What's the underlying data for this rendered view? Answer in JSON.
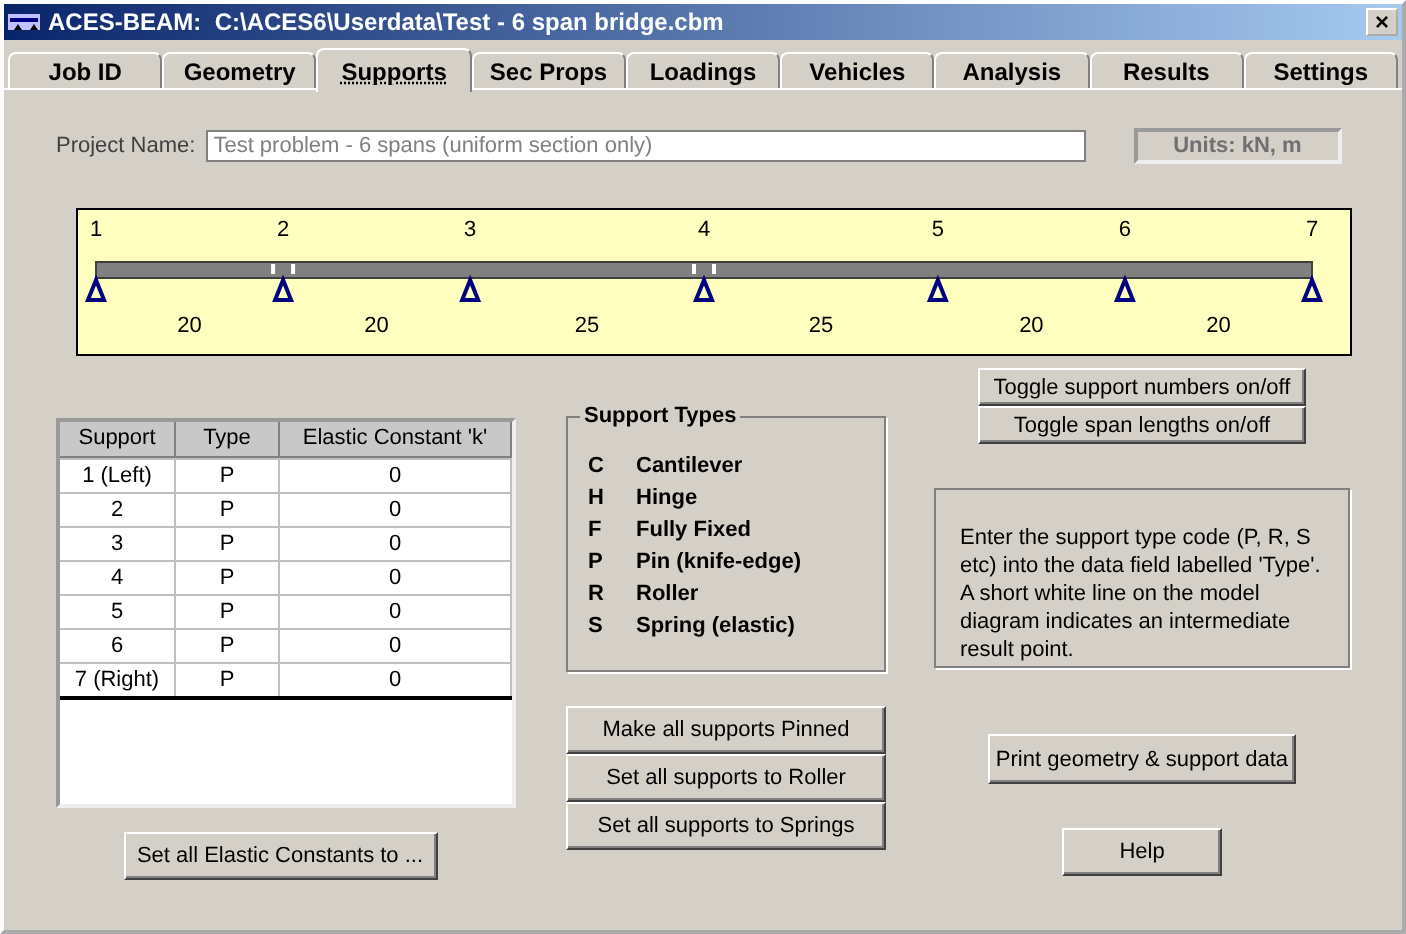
{
  "window": {
    "title": "ACES-BEAM:  C:\\ACES6\\Userdata\\Test - 6 span bridge.cbm",
    "close": "×"
  },
  "tabs": [
    {
      "label": "Job ID",
      "selected": false
    },
    {
      "label": "Geometry",
      "selected": false
    },
    {
      "label": "Supports",
      "selected": true
    },
    {
      "label": "Sec Props",
      "selected": false
    },
    {
      "label": "Loadings",
      "selected": false
    },
    {
      "label": "Vehicles",
      "selected": false
    },
    {
      "label": "Analysis",
      "selected": false
    },
    {
      "label": "Results",
      "selected": false
    },
    {
      "label": "Settings",
      "selected": false
    }
  ],
  "project": {
    "label": "Project Name:",
    "value": "Test problem - 6 spans (uniform section only)",
    "units": "Units: kN, m"
  },
  "beam": {
    "supports": [
      {
        "number": "1",
        "result_point": false
      },
      {
        "number": "2",
        "result_point": true
      },
      {
        "number": "3",
        "result_point": false
      },
      {
        "number": "4",
        "result_point": true
      },
      {
        "number": "5",
        "result_point": false
      },
      {
        "number": "6",
        "result_point": false
      },
      {
        "number": "7",
        "result_point": false
      }
    ],
    "spans": [
      {
        "length": "20"
      },
      {
        "length": "20"
      },
      {
        "length": "25"
      },
      {
        "length": "25"
      },
      {
        "length": "20"
      },
      {
        "length": "20"
      }
    ]
  },
  "toggle_buttons": [
    "Toggle support numbers on/off",
    "Toggle span lengths on/off"
  ],
  "table": {
    "columns": [
      "Support",
      "Type",
      "Elastic Constant 'k'"
    ],
    "rows": [
      [
        "1 (Left)",
        "P",
        "0"
      ],
      [
        "2",
        "P",
        "0"
      ],
      [
        "3",
        "P",
        "0"
      ],
      [
        "4",
        "P",
        "0"
      ],
      [
        "5",
        "P",
        "0"
      ],
      [
        "6",
        "P",
        "0"
      ],
      [
        "7 (Right)",
        "P",
        "0"
      ]
    ]
  },
  "elastic_button": "Set all Elastic Constants to ...",
  "support_types": {
    "title": "Support Types",
    "items": [
      {
        "code": "C",
        "name": "Cantilever"
      },
      {
        "code": "H",
        "name": "Hinge"
      },
      {
        "code": "F",
        "name": "Fully Fixed"
      },
      {
        "code": "P",
        "name": "Pin (knife-edge)"
      },
      {
        "code": "R",
        "name": "Roller"
      },
      {
        "code": "S",
        "name": "Spring (elastic)"
      }
    ]
  },
  "set_buttons": [
    "Make all supports Pinned",
    "Set all supports to Roller",
    "Set all supports to Springs"
  ],
  "info": "Enter the support type code (P, R, S etc) into the data field labelled 'Type'. A short white line on the model diagram indicates an intermediate result point.",
  "print_button": "Print geometry & support data",
  "help_button": "Help"
}
